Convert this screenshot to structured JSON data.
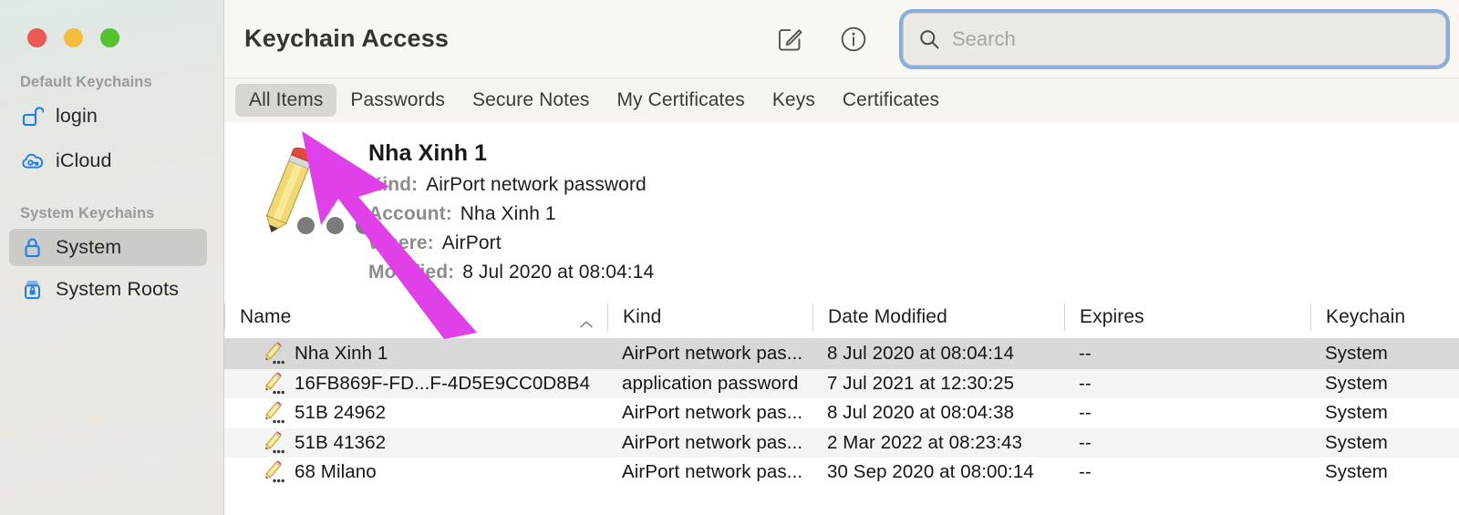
{
  "window": {
    "traffic_lights": [
      {
        "name": "close",
        "color": "#eb5a52"
      },
      {
        "name": "minimize",
        "color": "#f5bd3f"
      },
      {
        "name": "zoom",
        "color": "#53c32f"
      }
    ]
  },
  "sidebar": {
    "sections": [
      {
        "title": "Default Keychains",
        "items": [
          {
            "label": "login",
            "icon": "unlocked-padlock-icon",
            "selected": false
          },
          {
            "label": "iCloud",
            "icon": "cloud-key-icon",
            "selected": false
          }
        ]
      },
      {
        "title": "System Keychains",
        "items": [
          {
            "label": "System",
            "icon": "locked-padlock-icon",
            "selected": true
          },
          {
            "label": "System Roots",
            "icon": "keychain-lock-icon",
            "selected": false
          }
        ]
      }
    ]
  },
  "toolbar": {
    "title": "Keychain Access",
    "compose_label": "compose-icon",
    "info_label": "info-icon"
  },
  "search": {
    "placeholder": "Search",
    "value": "",
    "focused": true,
    "focus_ring_color": "#88aee0"
  },
  "tabs": [
    {
      "label": "All Items",
      "active": true
    },
    {
      "label": "Passwords",
      "active": false
    },
    {
      "label": "Secure Notes",
      "active": false
    },
    {
      "label": "My Certificates",
      "active": false
    },
    {
      "label": "Keys",
      "active": false
    },
    {
      "label": "Certificates",
      "active": false
    }
  ],
  "detail": {
    "icon": "pencil-icon",
    "title": "Nha Xinh 1",
    "fields": [
      {
        "label": "Kind:",
        "value": "AirPort network password"
      },
      {
        "label": "Account:",
        "value": "Nha Xinh 1"
      },
      {
        "label": "Where:",
        "value": "AirPort"
      },
      {
        "label": "Modified:",
        "value": "8 Jul 2020 at 08:04:14"
      }
    ]
  },
  "table": {
    "columns": [
      {
        "label": "Name",
        "sorted": true,
        "sort_direction": "ascending"
      },
      {
        "label": "Kind",
        "sorted": false
      },
      {
        "label": "Date Modified",
        "sorted": false
      },
      {
        "label": "Expires",
        "sorted": false
      },
      {
        "label": "Keychain",
        "sorted": false
      }
    ],
    "rows": [
      {
        "name": "Nha Xinh 1",
        "kind": "AirPort network pas...",
        "date_modified": "8 Jul 2020 at 08:04:14",
        "expires": "--",
        "keychain": "System",
        "selected": true
      },
      {
        "name": "16FB869F-FD...F-4D5E9CC0D8B4",
        "kind": "application password",
        "date_modified": "7 Jul 2021 at 12:30:25",
        "expires": "--",
        "keychain": "System",
        "selected": false
      },
      {
        "name": "51B 24962",
        "kind": "AirPort network pas...",
        "date_modified": "8 Jul 2020 at 08:04:38",
        "expires": "--",
        "keychain": "System",
        "selected": false
      },
      {
        "name": "51B 41362",
        "kind": "AirPort network pas...",
        "date_modified": "2 Mar 2022 at 08:23:43",
        "expires": "--",
        "keychain": "System",
        "selected": false
      },
      {
        "name": "68 Milano",
        "kind": "AirPort network pas...",
        "date_modified": "30 Sep 2020 at 08:00:14",
        "expires": "--",
        "keychain": "System",
        "selected": false
      }
    ]
  },
  "annotation": {
    "type": "arrow",
    "color": "#e040e8",
    "points_to": "All Items"
  }
}
